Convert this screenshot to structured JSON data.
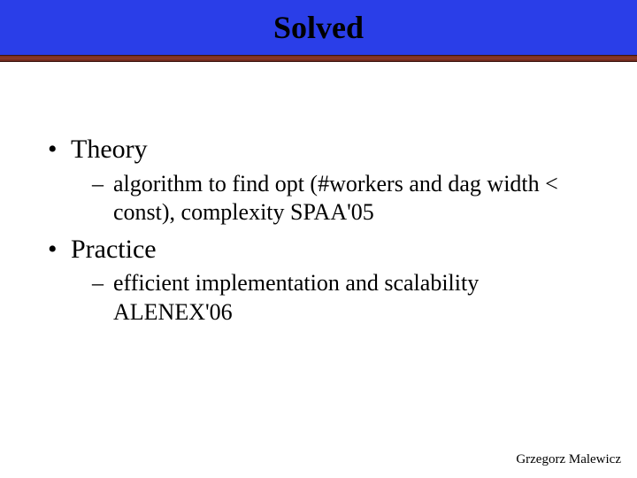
{
  "title": "Solved",
  "bullets": {
    "theory_label": "Theory",
    "theory_sub": "algorithm to find opt (#workers and dag width < const), complexity SPAA'05",
    "practice_label": "Practice",
    "practice_sub": "efficient implementation and scalability ALENEX'06"
  },
  "footer": "Grzegorz Malewicz"
}
